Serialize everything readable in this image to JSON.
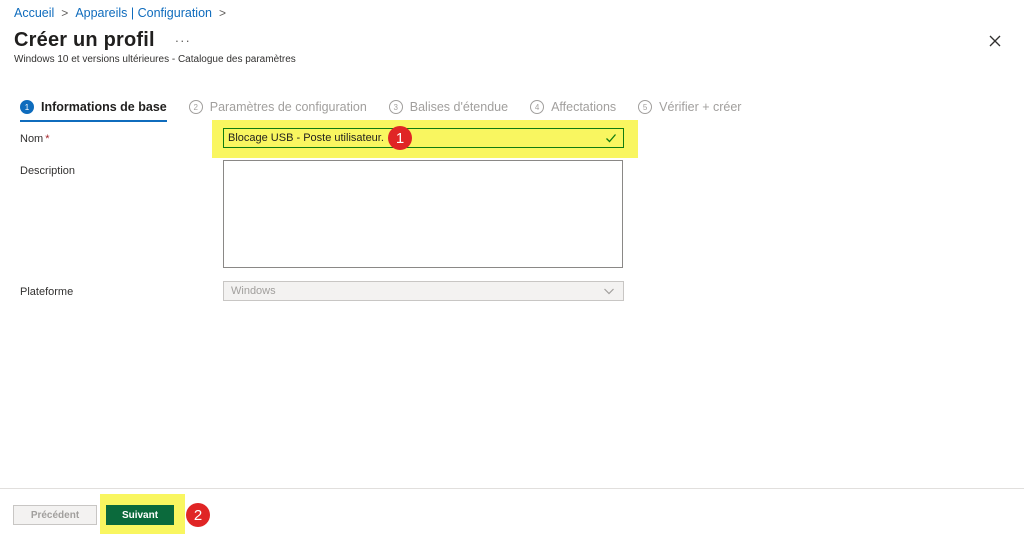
{
  "breadcrumb": {
    "home": "Accueil",
    "section": "Appareils | Configuration"
  },
  "header": {
    "title": "Créer un profil",
    "more": "···",
    "subtitle": "Windows 10 et versions ultérieures - Catalogue des paramètres"
  },
  "steps": [
    {
      "num": "1",
      "label": "Informations de base",
      "active": true
    },
    {
      "num": "2",
      "label": "Paramètres de configuration"
    },
    {
      "num": "3",
      "label": "Balises d'étendue"
    },
    {
      "num": "4",
      "label": "Affectations"
    },
    {
      "num": "5",
      "label": "Vérifier + créer"
    }
  ],
  "form": {
    "name_label": "Nom",
    "required_mark": "*",
    "name_value": "Blocage USB - Poste utilisateur.",
    "description_label": "Description",
    "description_value": "",
    "platform_label": "Plateforme",
    "platform_value": "Windows"
  },
  "annotations": {
    "badge1": "1",
    "badge2": "2"
  },
  "footer": {
    "prev_label": "Précédent",
    "next_label": "Suivant"
  },
  "colors": {
    "accent": "#0f6cbd",
    "primary_button": "#0b6a3c",
    "highlight": "#f9f660",
    "badge": "#e02525",
    "valid": "#107c10"
  }
}
